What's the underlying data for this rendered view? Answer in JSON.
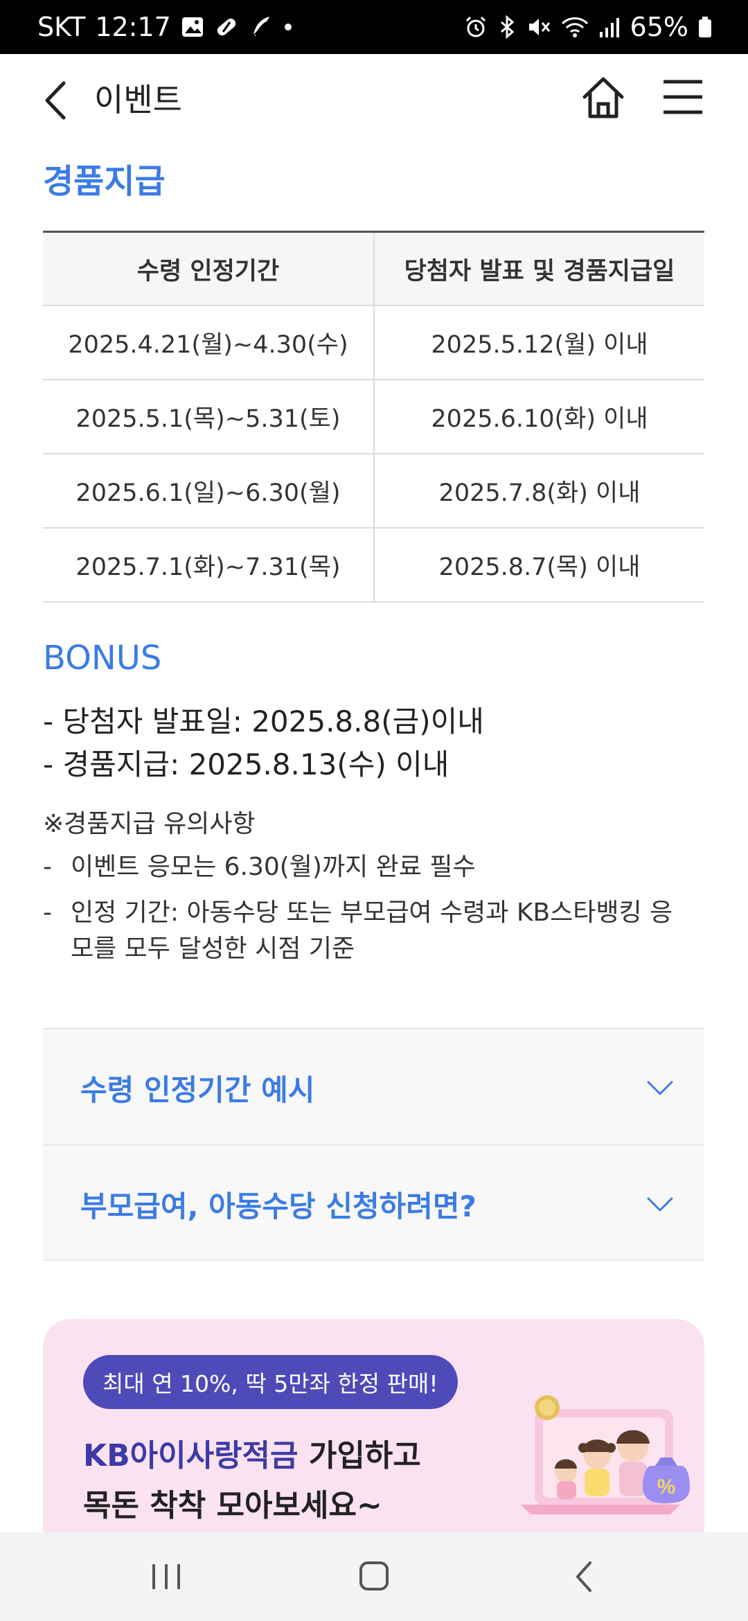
{
  "status_bar": {
    "carrier": "SKT",
    "time": "12:17",
    "battery": "65%"
  },
  "header": {
    "title": "이벤트"
  },
  "prize": {
    "title": "경품지급",
    "table": {
      "headers": [
        "수령 인정기간",
        "당첨자 발표 및 경품지급일"
      ],
      "rows": [
        [
          "2025.4.21(월)~4.30(수)",
          "2025.5.12(월) 이내"
        ],
        [
          "2025.5.1(목)~5.31(토)",
          "2025.6.10(화) 이내"
        ],
        [
          "2025.6.1(일)~6.30(월)",
          "2025.7.8(화) 이내"
        ],
        [
          "2025.7.1(화)~7.31(목)",
          "2025.8.7(목) 이내"
        ]
      ]
    }
  },
  "bonus": {
    "title": "BONUS",
    "lines": [
      "- 당첨자 발표일: 2025.8.8(금)이내",
      "- 경품지급: 2025.8.13(수) 이내"
    ]
  },
  "notice": {
    "title": "※경품지급 유의사항",
    "items": [
      "이벤트 응모는 6.30(월)까지 완료 필수",
      "인정 기간: 아동수당 또는 부모급여 수령과 KB스타뱅킹 응모를 모두 달성한 시점 기준"
    ]
  },
  "accordions": [
    {
      "label": "수령 인정기간 예시"
    },
    {
      "label": "부모급여, 아동수당 신청하려면?"
    }
  ],
  "promo": {
    "pill": "최대 연 10%, 딱 5만좌 한정 판매!",
    "title_brand": "KB아이사랑적금",
    "title_rest": " 가입하고",
    "title_line2": "목돈 착착 모아보세요~"
  },
  "colors": {
    "accent": "#3b7be6",
    "promo_bg": "#fbe2f0",
    "pill_bg": "#4e4ab8"
  }
}
